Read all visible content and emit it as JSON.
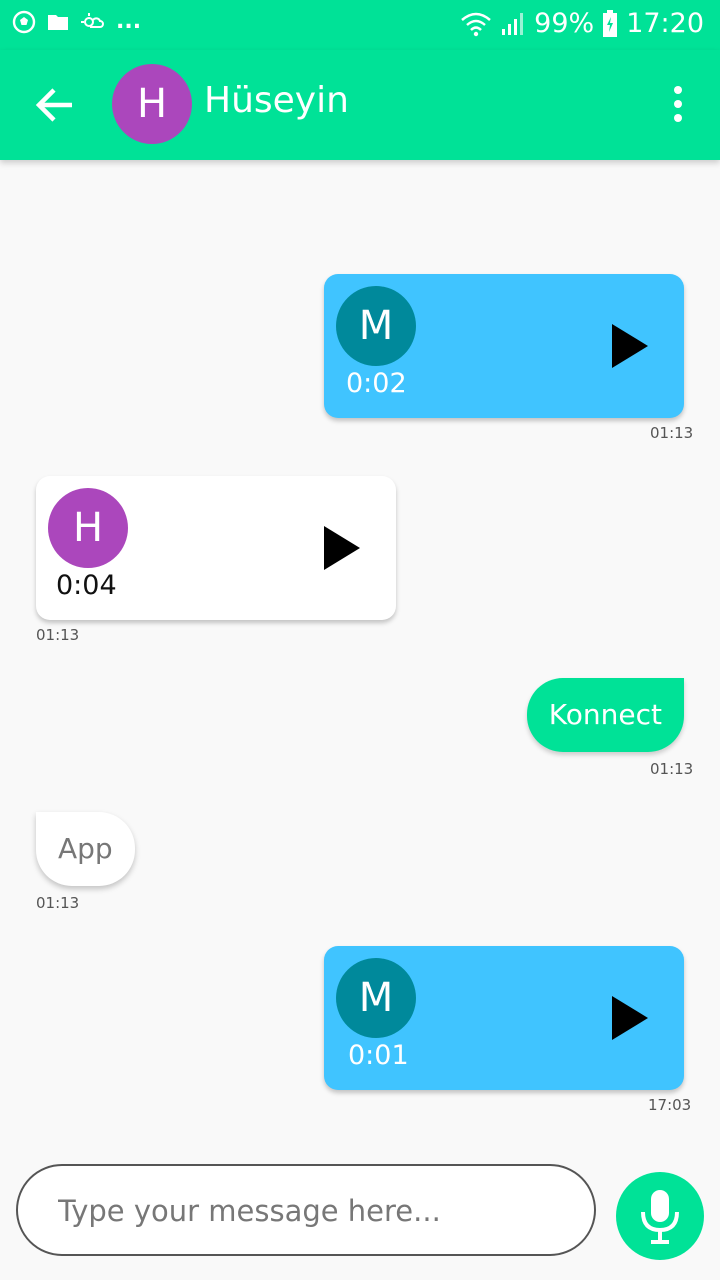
{
  "status_bar": {
    "battery": "99%",
    "time": "17:20",
    "overflow_dots": "...",
    "icons": [
      "soccer-ball-icon",
      "folder-icon",
      "weather-icon",
      "wifi-icon",
      "signal-icon",
      "battery-charging-icon"
    ]
  },
  "header": {
    "title": "Hüseyin",
    "avatar_letter": "H",
    "back_icon": "arrow-back-icon",
    "menu_icon": "more-vert-icon"
  },
  "messages": [
    {
      "kind": "voice",
      "direction": "sent",
      "avatar_letter": "M",
      "duration": "0:02",
      "time": "01:13"
    },
    {
      "kind": "voice",
      "direction": "received",
      "avatar_letter": "H",
      "duration": "0:04",
      "time": "01:13"
    },
    {
      "kind": "text",
      "direction": "sent",
      "text": "Konnect",
      "time": "01:13"
    },
    {
      "kind": "text",
      "direction": "received",
      "text": "App",
      "time": "01:13"
    },
    {
      "kind": "voice",
      "direction": "sent",
      "avatar_letter": "M",
      "duration": "0:01",
      "time": "17:03"
    }
  ],
  "composer": {
    "placeholder": "Type your message here...",
    "value": "",
    "mic_icon": "microphone-icon"
  },
  "colors": {
    "primary": "#00e297",
    "sent_voice_bubble": "#40c4ff",
    "avatar_m": "#00899b",
    "avatar_h": "#ab47bc",
    "background": "#f9f9f9"
  }
}
